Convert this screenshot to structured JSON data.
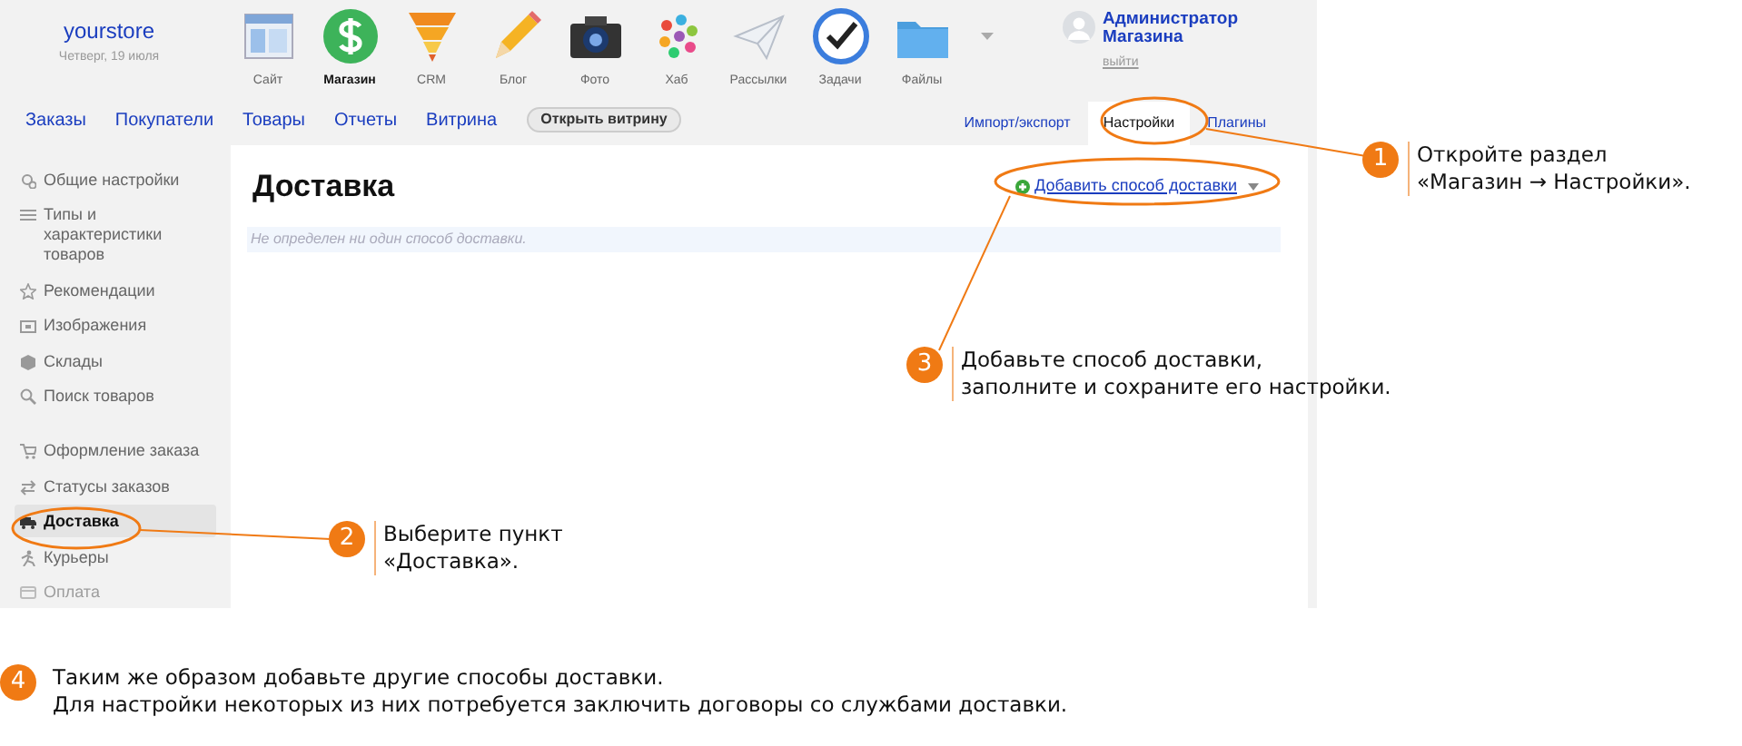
{
  "store": {
    "name": "yourstore",
    "date": "Четверг, 19 июля"
  },
  "apps": [
    {
      "label": "Сайт",
      "selected": false
    },
    {
      "label": "Магазин",
      "selected": true
    },
    {
      "label": "CRM",
      "selected": false
    },
    {
      "label": "Блог",
      "selected": false
    },
    {
      "label": "Фото",
      "selected": false
    },
    {
      "label": "Хаб",
      "selected": false
    },
    {
      "label": "Рассылки",
      "selected": false
    },
    {
      "label": "Задачи",
      "selected": false
    },
    {
      "label": "Файлы",
      "selected": false
    }
  ],
  "user": {
    "name": "Администратор Магазина",
    "logout": "выйти"
  },
  "nav": [
    "Заказы",
    "Покупатели",
    "Товары",
    "Отчеты",
    "Витрина"
  ],
  "open_storefront_button": "Открыть витрину",
  "right_tabs": [
    {
      "label": "Импорт/экспорт",
      "selected": false
    },
    {
      "label": "Настройки",
      "selected": true
    },
    {
      "label": "Плагины",
      "selected": false
    }
  ],
  "sidebar": [
    {
      "label": "Общие настройки",
      "selected": false
    },
    {
      "label": "Типы и характеристики товаров",
      "selected": false
    },
    {
      "label": "Рекомендации",
      "selected": false
    },
    {
      "label": "Изображения",
      "selected": false
    },
    {
      "label": "Склады",
      "selected": false
    },
    {
      "label": "Поиск товаров",
      "selected": false
    },
    {
      "label": "Оформление заказа",
      "selected": false
    },
    {
      "label": "Статусы заказов",
      "selected": false
    },
    {
      "label": "Доставка",
      "selected": true
    },
    {
      "label": "Курьеры",
      "selected": false
    },
    {
      "label": "Оплата",
      "selected": false
    }
  ],
  "page": {
    "title": "Доставка",
    "add_link": "Добавить способ доставки",
    "empty_message": "Не определен ни один способ доставки."
  },
  "callouts": [
    {
      "number": "1",
      "lines": [
        "Откройте раздел",
        "«Магазин → Настройки»."
      ]
    },
    {
      "number": "2",
      "lines": [
        "Выберите пункт",
        "«Доставка»."
      ]
    },
    {
      "number": "3",
      "lines": [
        "Добавьте способ доставки,",
        "заполните и сохраните его настройки."
      ]
    },
    {
      "number": "4",
      "lines": [
        "Таким же образом добавьте другие способы доставки.",
        "Для настройки некоторых из них потребуется заключить договоры со службами доставки."
      ]
    }
  ]
}
